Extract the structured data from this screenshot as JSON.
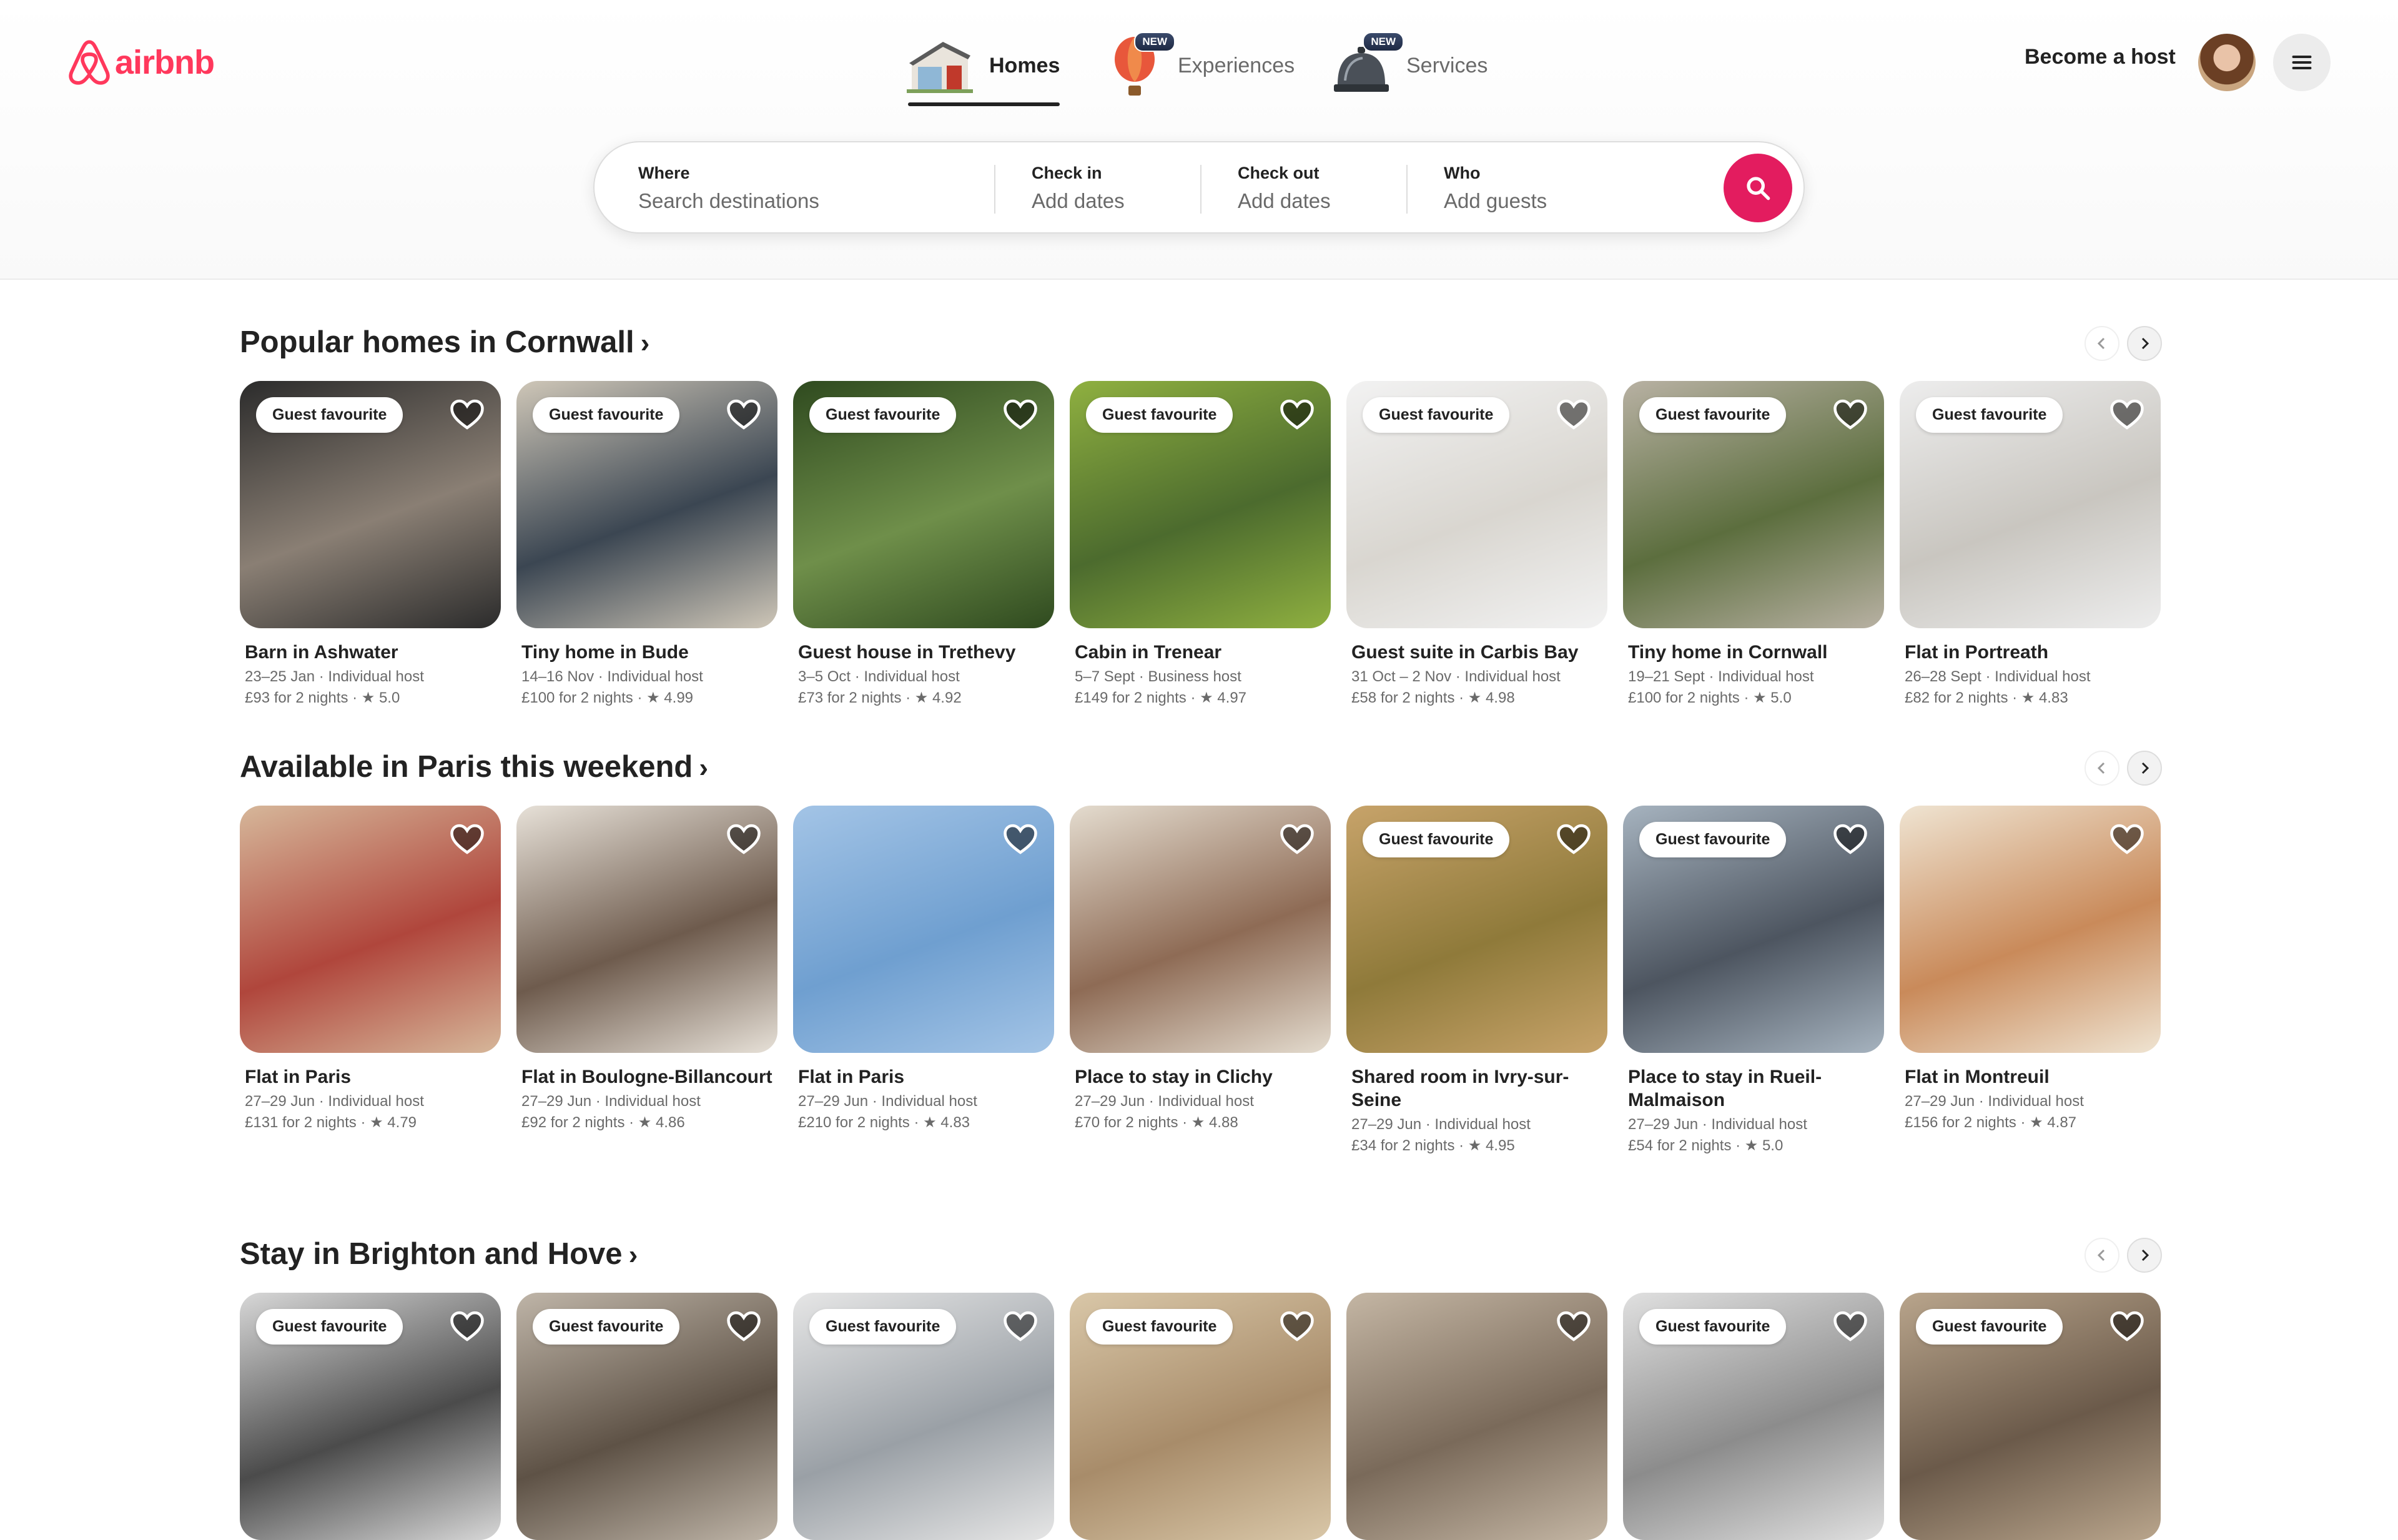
{
  "brand": {
    "name": "airbnb",
    "color": "#ff385c"
  },
  "nav": {
    "homes": {
      "label": "Homes",
      "icon": "house-icon"
    },
    "experiences": {
      "label": "Experiences",
      "badge": "NEW",
      "icon": "hot-air-balloon-icon"
    },
    "services": {
      "label": "Services",
      "badge": "NEW",
      "icon": "service-bell-icon"
    }
  },
  "header": {
    "become_host": "Become a host"
  },
  "search": {
    "where": {
      "label": "Where",
      "placeholder": "Search destinations"
    },
    "checkin": {
      "label": "Check in",
      "placeholder": "Add dates"
    },
    "checkout": {
      "label": "Check out",
      "placeholder": "Add dates"
    },
    "who": {
      "label": "Who",
      "placeholder": "Add guests"
    },
    "accent": "#e31c5f"
  },
  "sections": [
    {
      "title": "Popular homes in Cornwall",
      "chevron": "›",
      "cards": [
        {
          "badge": "Guest favourite",
          "title": "Barn in Ashwater",
          "line1": "23–25 Jan · Individual host",
          "line2": "£93 for 2 nights · ★ 5.0"
        },
        {
          "badge": "Guest favourite",
          "title": "Tiny home in Bude",
          "line1": "14–16 Nov · Individual host",
          "line2": "£100 for 2 nights · ★ 4.99"
        },
        {
          "badge": "Guest favourite",
          "title": "Guest house in Trethevy",
          "line1": "3–5 Oct · Individual host",
          "line2": "£73 for 2 nights · ★ 4.92"
        },
        {
          "badge": "Guest favourite",
          "title": "Cabin in Trenear",
          "line1": "5–7 Sept · Business host",
          "line2": "£149 for 2 nights · ★ 4.97"
        },
        {
          "badge": "Guest favourite",
          "title": "Guest suite in Carbis Bay",
          "line1": "31 Oct – 2 Nov · Individual host",
          "line2": "£58 for 2 nights · ★ 4.98"
        },
        {
          "badge": "Guest favourite",
          "title": "Tiny home in Cornwall",
          "line1": "19–21 Sept · Individual host",
          "line2": "£100 for 2 nights · ★ 5.0"
        },
        {
          "badge": "Guest favourite",
          "title": "Flat in Portreath",
          "line1": "26–28 Sept · Individual host",
          "line2": "£82 for 2 nights · ★ 4.83"
        }
      ]
    },
    {
      "title": "Available in Paris this weekend",
      "chevron": "›",
      "cards": [
        {
          "badge": "",
          "title": "Flat in Paris",
          "line1": "27–29 Jun · Individual host",
          "line2": "£131 for 2 nights · ★ 4.79"
        },
        {
          "badge": "",
          "title": "Flat in Boulogne-Billancourt",
          "line1": "27–29 Jun · Individual host",
          "line2": "£92 for 2 nights · ★ 4.86"
        },
        {
          "badge": "",
          "title": "Flat in Paris",
          "line1": "27–29 Jun · Individual host",
          "line2": "£210 for 2 nights · ★ 4.83"
        },
        {
          "badge": "",
          "title": "Place to stay in Clichy",
          "line1": "27–29 Jun · Individual host",
          "line2": "£70 for 2 nights · ★ 4.88"
        },
        {
          "badge": "Guest favourite",
          "title": "Shared room in Ivry-sur-Seine",
          "line1": "27–29 Jun · Individual host",
          "line2": "£34 for 2 nights · ★ 4.95"
        },
        {
          "badge": "Guest favourite",
          "title": "Place to stay in Rueil-Malmaison",
          "line1": "27–29 Jun · Individual host",
          "line2": "£54 for 2 nights · ★ 5.0"
        },
        {
          "badge": "",
          "title": "Flat in Montreuil",
          "line1": "27–29 Jun · Individual host",
          "line2": "£156 for 2 nights · ★ 4.87"
        }
      ]
    },
    {
      "title": "Stay in Brighton and Hove",
      "chevron": "›",
      "cards": [
        {
          "badge": "Guest favourite",
          "title": "",
          "line1": "",
          "line2": ""
        },
        {
          "badge": "Guest favourite",
          "title": "",
          "line1": "",
          "line2": ""
        },
        {
          "badge": "Guest favourite",
          "title": "",
          "line1": "",
          "line2": ""
        },
        {
          "badge": "Guest favourite",
          "title": "",
          "line1": "",
          "line2": ""
        },
        {
          "badge": "",
          "title": "",
          "line1": "",
          "line2": ""
        },
        {
          "badge": "Guest favourite",
          "title": "",
          "line1": "",
          "line2": ""
        },
        {
          "badge": "Guest favourite",
          "title": "",
          "line1": "",
          "line2": ""
        }
      ]
    }
  ]
}
